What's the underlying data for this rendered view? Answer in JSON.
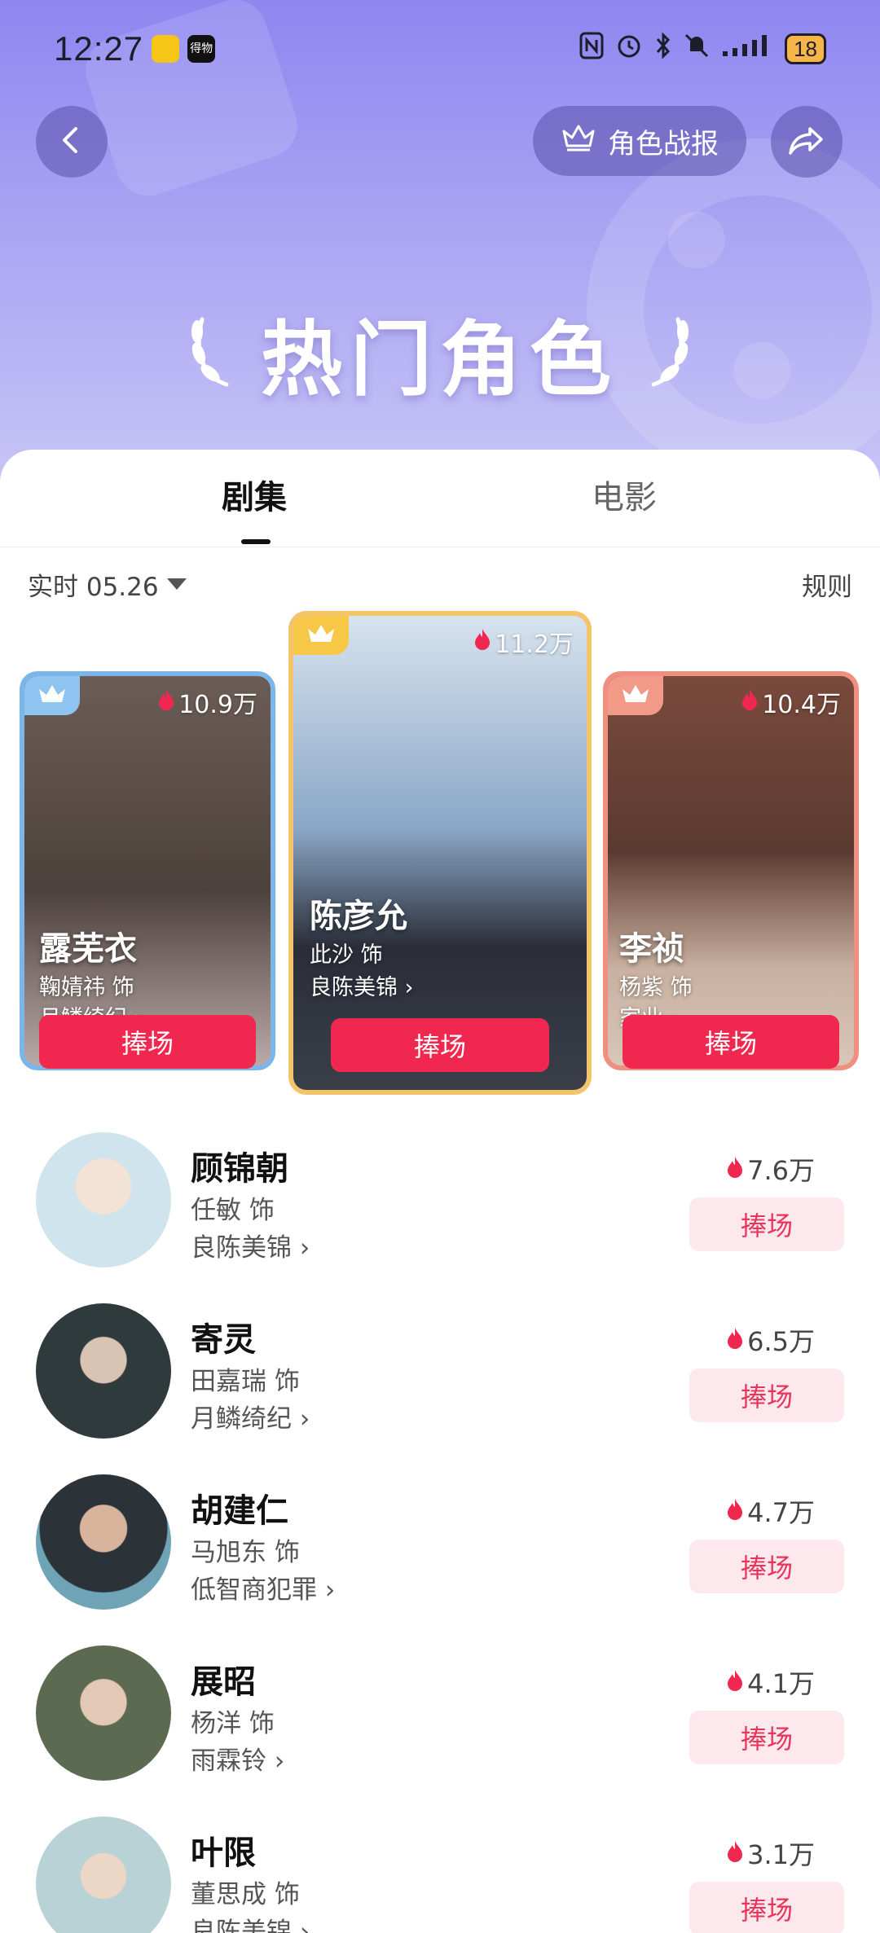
{
  "status_bar": {
    "time": "12:27",
    "app1_label": "得物",
    "battery": "18"
  },
  "header": {
    "back_icon": "chevron-left-icon",
    "report_label": "角色战报",
    "report_icon": "crown-outline-icon",
    "share_icon": "share-arrow-icon",
    "title": "热门角色"
  },
  "tabs": [
    {
      "label": "剧集",
      "active": true
    },
    {
      "label": "电影",
      "active": false
    }
  ],
  "filter": {
    "label": "实时 05.26",
    "rule_label": "规则"
  },
  "top_cards": [
    {
      "rank": 2,
      "heat": "10.9万",
      "name": "露芜衣",
      "actor": "鞠婧祎 饰",
      "drama": "月鳞绮纪",
      "cheer": "捧场",
      "frame_color": "#7bb6ea",
      "badge_color": "#8fc4f0",
      "photo_tone": "#5b4d48"
    },
    {
      "rank": 1,
      "heat": "11.2万",
      "name": "陈彦允",
      "actor": "此沙 饰",
      "drama": "良陈美锦",
      "cheer": "捧场",
      "frame_color": "#f3c46a",
      "badge_color": "#f7c848",
      "photo_tone": "#8aa7c6"
    },
    {
      "rank": 3,
      "heat": "10.4万",
      "name": "李祯",
      "actor": "杨紫 饰",
      "drama": "家业",
      "cheer": "捧场",
      "frame_color": "#ee8f80",
      "badge_color": "#f19a88",
      "photo_tone": "#7a4a3c"
    }
  ],
  "list": [
    {
      "name": "顾锦朝",
      "actor": "任敏 饰",
      "drama": "良陈美锦",
      "heat": "7.6万",
      "cheer": "捧场",
      "avatar_tone": "#cfe4ec"
    },
    {
      "name": "寄灵",
      "actor": "田嘉瑞 饰",
      "drama": "月鳞绮纪",
      "heat": "6.5万",
      "cheer": "捧场",
      "avatar_tone": "#2e3a3c"
    },
    {
      "name": "胡建仁",
      "actor": "马旭东 饰",
      "drama": "低智商犯罪",
      "heat": "4.7万",
      "cheer": "捧场",
      "avatar_tone": "#6ea4b5"
    },
    {
      "name": "展昭",
      "actor": "杨洋 饰",
      "drama": "雨霖铃",
      "heat": "4.1万",
      "cheer": "捧场",
      "avatar_tone": "#5c6a52"
    },
    {
      "name": "叶限",
      "actor": "董思成 饰",
      "drama": "良陈美锦",
      "heat": "3.1万",
      "cheer": "捧场",
      "avatar_tone": "#b9d2d6"
    }
  ],
  "colors": {
    "accent": "#f0284f",
    "header_top": "#8f86f0",
    "cheer_soft_bg": "#fde8ed"
  }
}
